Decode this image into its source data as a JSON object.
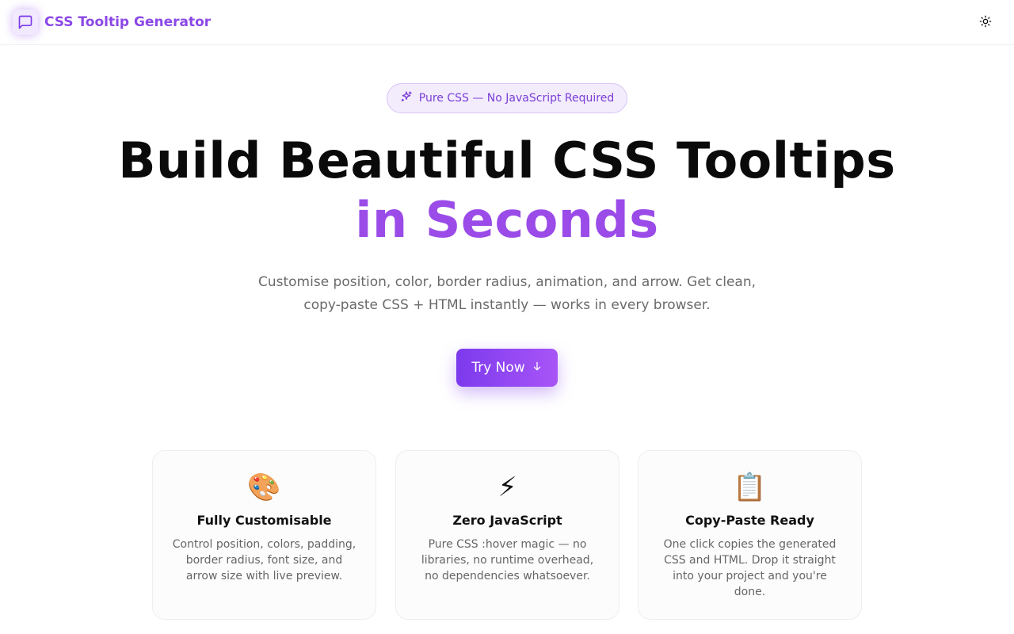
{
  "header": {
    "title": "CSS Tooltip Generator",
    "logo_icon": "message-square-icon",
    "theme_icon": "sun-icon"
  },
  "hero": {
    "badge_icon": "sparkles-icon",
    "badge": "Pure CSS — No JavaScript Required",
    "title_line1": "Build Beautiful CSS Tooltips",
    "title_line2": "in Seconds",
    "subtitle_line1": "Customise position, color, border radius, animation, and arrow. Get clean,",
    "subtitle_line2": "copy-paste CSS + HTML instantly — works in every browser.",
    "cta_label": "Try Now",
    "cta_icon": "arrow-down-icon"
  },
  "features": [
    {
      "icon": "🎨",
      "icon_name": "palette-icon",
      "title": "Fully Customisable",
      "desc_line1": "Control position, colors, padding,",
      "desc_line2": "border radius, font size, and",
      "desc_line3": "arrow size with live preview.",
      "desc_line4": ""
    },
    {
      "icon": "⚡",
      "icon_name": "lightning-icon",
      "title": "Zero JavaScript",
      "desc_line1": "Pure CSS :hover magic — no",
      "desc_line2": "libraries, no runtime overhead,",
      "desc_line3": "no dependencies whatsoever.",
      "desc_line4": ""
    },
    {
      "icon": "📋",
      "icon_name": "clipboard-icon",
      "title": "Copy-Paste Ready",
      "desc_line1": "One click copies the generated",
      "desc_line2": "CSS and HTML. Drop it straight",
      "desc_line3": "into your project and you're",
      "desc_line4": "done."
    }
  ],
  "colors": {
    "accent": "#9a4be8",
    "accent_dark": "#7c3aed",
    "badge_bg": "#f3ecfd"
  }
}
